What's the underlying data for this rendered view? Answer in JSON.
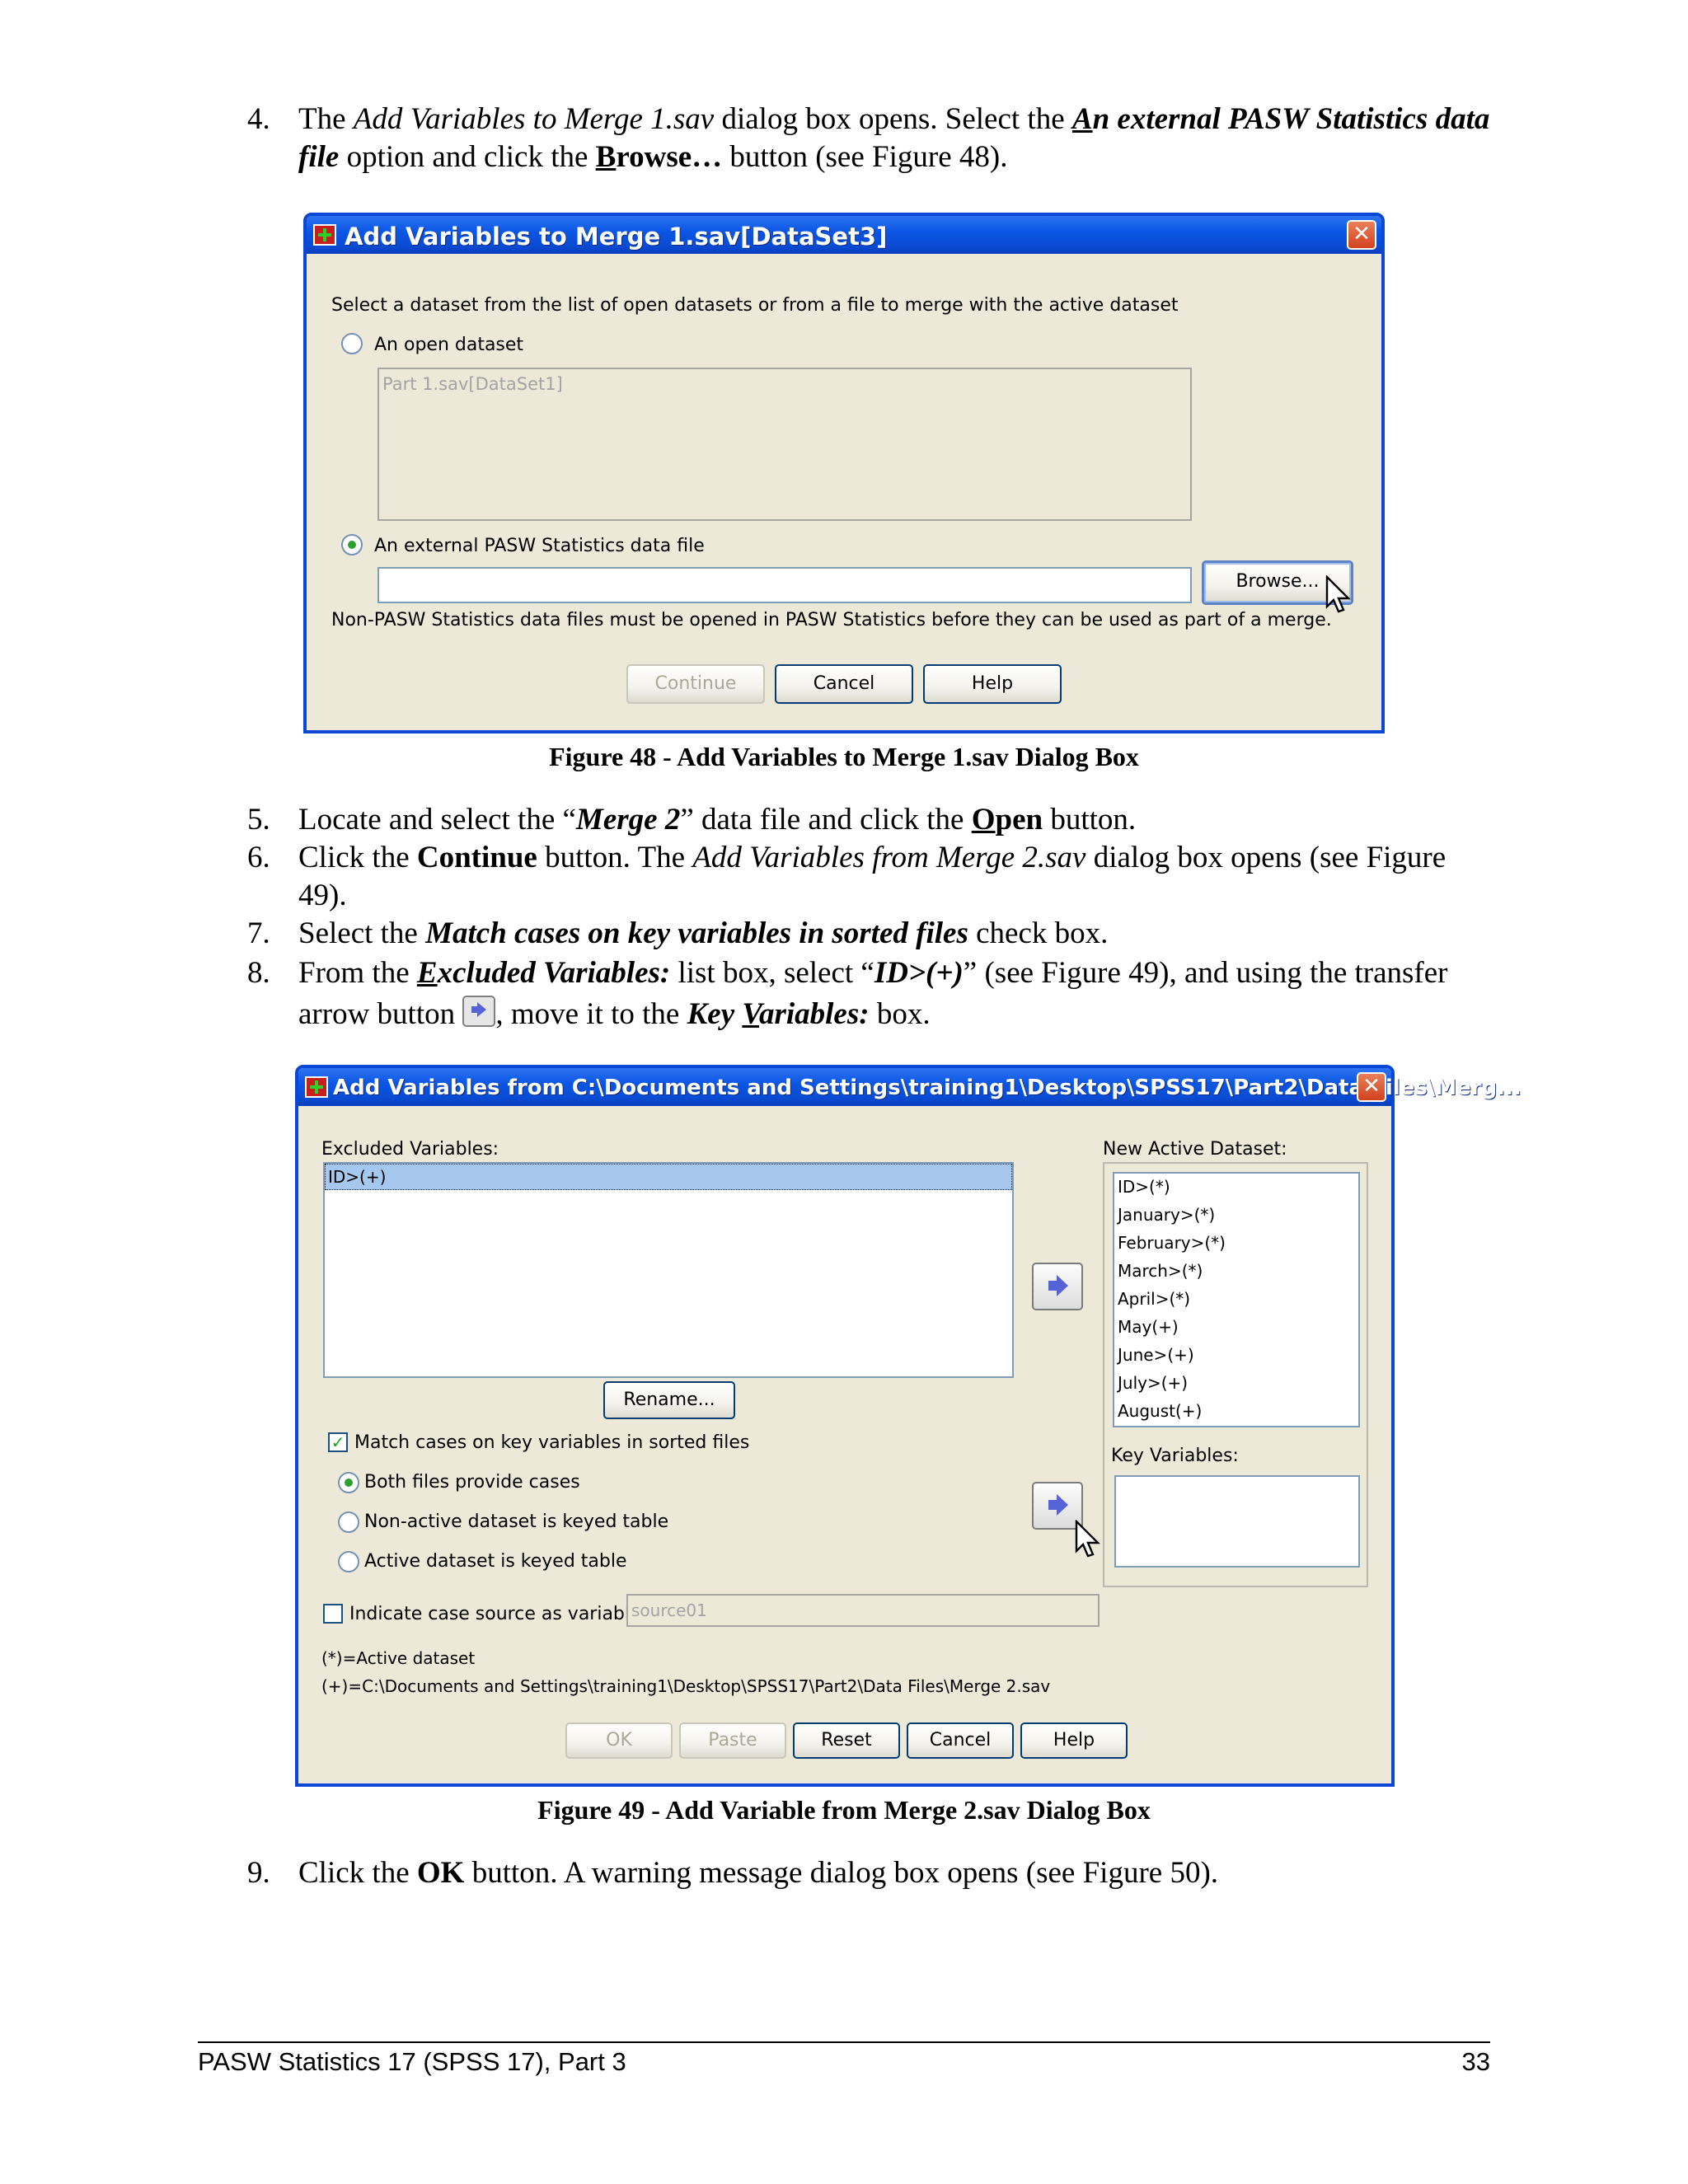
{
  "steps": {
    "s4": {
      "num": "4.",
      "t1": "The ",
      "t2": "Add Variables to Merge 1.sav",
      "t3": " dialog box opens. Select the ",
      "t4a": "A",
      "t4b": "n external PASW Statistics data file",
      "t5": " option and click the ",
      "t6a": "B",
      "t6b": "rowse…",
      "t7": " button (see Figure 48)."
    },
    "s5": {
      "num": "5.",
      "t1": "Locate and select the “",
      "t2": "Merge 2",
      "t3": "” data file and click the ",
      "t4a": "O",
      "t4b": "pen",
      "t5": " button."
    },
    "s6": {
      "num": "6.",
      "t1": "Click the ",
      "t2": "Continue",
      "t3": " button. The ",
      "t4": "Add Variables from Merge 2.sav",
      "t5": " dialog box opens (see Figure 49)."
    },
    "s7": {
      "num": "7.",
      "t1": "Select the ",
      "t2": "Match cases on key variables in sorted files",
      "t3": " check box."
    },
    "s8": {
      "num": "8.",
      "t1": "From the ",
      "t2a": "E",
      "t2b": "xcluded Variables:",
      "t3": " list box, select “",
      "t4": "ID>(+)",
      "t5": "” (see Figure 49), and using the transfer arrow button ",
      "t6": ", move it to the ",
      "t7a": "Key ",
      "t7b": "V",
      "t7c": "ariables:",
      "t8": " box."
    },
    "s9": {
      "num": "9.",
      "t1": "Click the ",
      "t2": "OK",
      "t3": " button. A warning message dialog box opens (see Figure 50)."
    }
  },
  "figure48": {
    "caption": "Figure 48 - Add Variables to Merge 1.sav Dialog Box",
    "title": "Add Variables to Merge 1.sav[DataSet3]",
    "instruction": "Select a dataset from the list of open datasets or from a file to merge with the active dataset",
    "radio_open_label": "An open dataset",
    "open_list_item": "Part 1.sav[DataSet1]",
    "radio_external_label": "An external PASW Statistics data file",
    "browse_label": "Browse...",
    "note": "Non-PASW Statistics data files must be opened in PASW Statistics before they can be used as part of a merge.",
    "continue_label": "Continue",
    "cancel_label": "Cancel",
    "help_label": "Help"
  },
  "figure49": {
    "caption": "Figure 49 - Add Variable from Merge 2.sav Dialog Box",
    "title": "Add Variables from C:\\Documents and Settings\\training1\\Desktop\\SPSS17\\Part2\\Data Files\\Merg...",
    "excluded_label": "Excluded Variables:",
    "excluded_items": [
      "ID>(+)"
    ],
    "rename_label": "Rename...",
    "match_label": "Match cases on key variables in sorted files",
    "both_label": "Both files provide cases",
    "nonactive_label": "Non-active dataset is keyed table",
    "active_label": "Active dataset is keyed table",
    "indicate_label": "Indicate case source as variable:",
    "source_value": "source01",
    "legend_active": "(*)=Active dataset",
    "legend_plus": "(+)=C:\\Documents and Settings\\training1\\Desktop\\SPSS17\\Part2\\Data Files\\Merge 2.sav",
    "new_active_label": "New Active Dataset:",
    "new_active_items": [
      "ID>(*)",
      "January>(*)",
      "February>(*)",
      "March>(*)",
      "April>(*)",
      "May(+)",
      "June>(+)",
      "July>(+)",
      "August(+)"
    ],
    "key_label": "Key Variables:",
    "ok_label": "OK",
    "paste_label": "Paste",
    "reset_label": "Reset",
    "cancel_label": "Cancel",
    "help_label": "Help"
  },
  "footer": {
    "left": "PASW Statistics 17 (SPSS 17), Part 3",
    "page": "33"
  },
  "colors": {
    "title_blue": "#0b56e4",
    "dialog_face": "#ece9d8",
    "selection": "#a6c8ef"
  }
}
